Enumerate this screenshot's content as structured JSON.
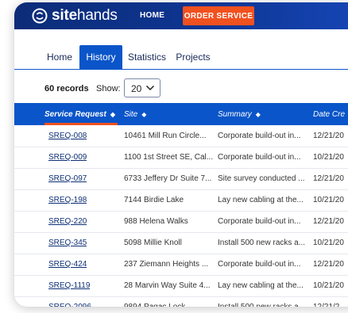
{
  "brand": {
    "name_bold": "site",
    "name_light": "hands"
  },
  "nav": {
    "home": "HOME",
    "order_service": "ORDER SERVICE"
  },
  "tabs": [
    {
      "label": "Home",
      "active": false
    },
    {
      "label": "History",
      "active": true
    },
    {
      "label": "Statistics",
      "active": false
    },
    {
      "label": "Projects",
      "active": false
    }
  ],
  "toolbar": {
    "records": "60 records",
    "show_label": "Show:",
    "show_value": "20"
  },
  "table": {
    "columns": [
      {
        "label": "Service Request",
        "sort": "◆",
        "sorted": true
      },
      {
        "label": "Site",
        "sort": "◆",
        "sorted": false
      },
      {
        "label": "Summary",
        "sort": "◆",
        "sorted": false
      },
      {
        "label": "Date Cre",
        "sort": "",
        "sorted": false
      }
    ],
    "rows": [
      {
        "id": "SREQ-008",
        "site": "10461 Mill Run Circle...",
        "summary": "Corporate build-out in...",
        "date": "12/21/20"
      },
      {
        "id": "SREQ-009",
        "site": "1100 1st Street SE, Cal...",
        "summary": "Corporate build-out in...",
        "date": "10/21/20"
      },
      {
        "id": "SREQ-097",
        "site": "6733 Jeffery Dr Suite 7...",
        "summary": "Site survey conducted ...",
        "date": "12/21/20"
      },
      {
        "id": "SREQ-198",
        "site": "7144 Birdie Lake",
        "summary": "Lay new cabling at the...",
        "date": "10/21/20"
      },
      {
        "id": "SREQ-220",
        "site": "988 Helena Walks",
        "summary": "Corporate build-out in...",
        "date": "12/21/20"
      },
      {
        "id": "SREQ-345",
        "site": "5098 Millie Knoll",
        "summary": "Install 500 new racks a...",
        "date": "10/21/20"
      },
      {
        "id": "SREQ-424",
        "site": "237 Ziemann Heights ...",
        "summary": "Corporate build-out in...",
        "date": "12/21/20"
      },
      {
        "id": "SREQ-1119",
        "site": "28 Marvin Way Suite 4...",
        "summary": "Lay new cabling at the...",
        "date": "10/21/20"
      },
      {
        "id": "SREQ-2096",
        "site": "9894 Pagac Lock",
        "summary": "Install 500 new racks a...",
        "date": "12/21/2"
      }
    ]
  },
  "colors": {
    "header_blue": "#0c2c78",
    "primary_blue": "#0a55c9",
    "accent_orange": "#f0511f"
  },
  "icons": [
    "sitehands-logo-icon",
    "chevron-down-icon",
    "sort-icon"
  ]
}
